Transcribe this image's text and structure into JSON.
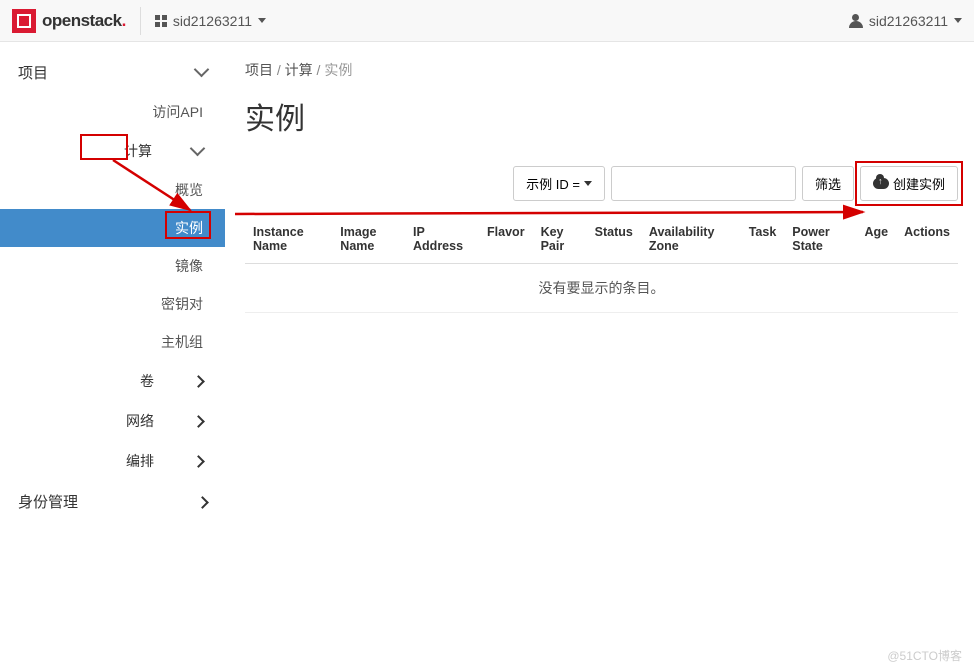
{
  "brand": {
    "name": "openstack"
  },
  "topbar": {
    "project_name": "sid21263211",
    "user_name": "sid21263211"
  },
  "sidebar": {
    "project_label": "项目",
    "api_label": "访问API",
    "compute_label": "计算",
    "overview_label": "概览",
    "instances_label": "实例",
    "images_label": "镜像",
    "keypairs_label": "密钥对",
    "hostgroups_label": "主机组",
    "volumes_label": "卷",
    "network_label": "网络",
    "orchestration_label": "编排",
    "identity_label": "身份管理"
  },
  "breadcrumb": {
    "a": "项目",
    "b": "计算",
    "c": "实例"
  },
  "page": {
    "title": "实例"
  },
  "toolbar": {
    "filter_dropdown_label": "示例 ID =",
    "filter_input_placeholder": "",
    "filter_button_label": "筛选",
    "create_button_label": "创建实例"
  },
  "table": {
    "headers": {
      "instance_name": "Instance Name",
      "image_name": "Image Name",
      "ip_address": "IP Address",
      "flavor": "Flavor",
      "key_pair": "Key Pair",
      "status": "Status",
      "availability_zone": "Availability Zone",
      "task": "Task",
      "power_state": "Power State",
      "age": "Age",
      "actions": "Actions"
    },
    "empty_message": "没有要显示的条目。"
  },
  "watermark": "@51CTO博客"
}
